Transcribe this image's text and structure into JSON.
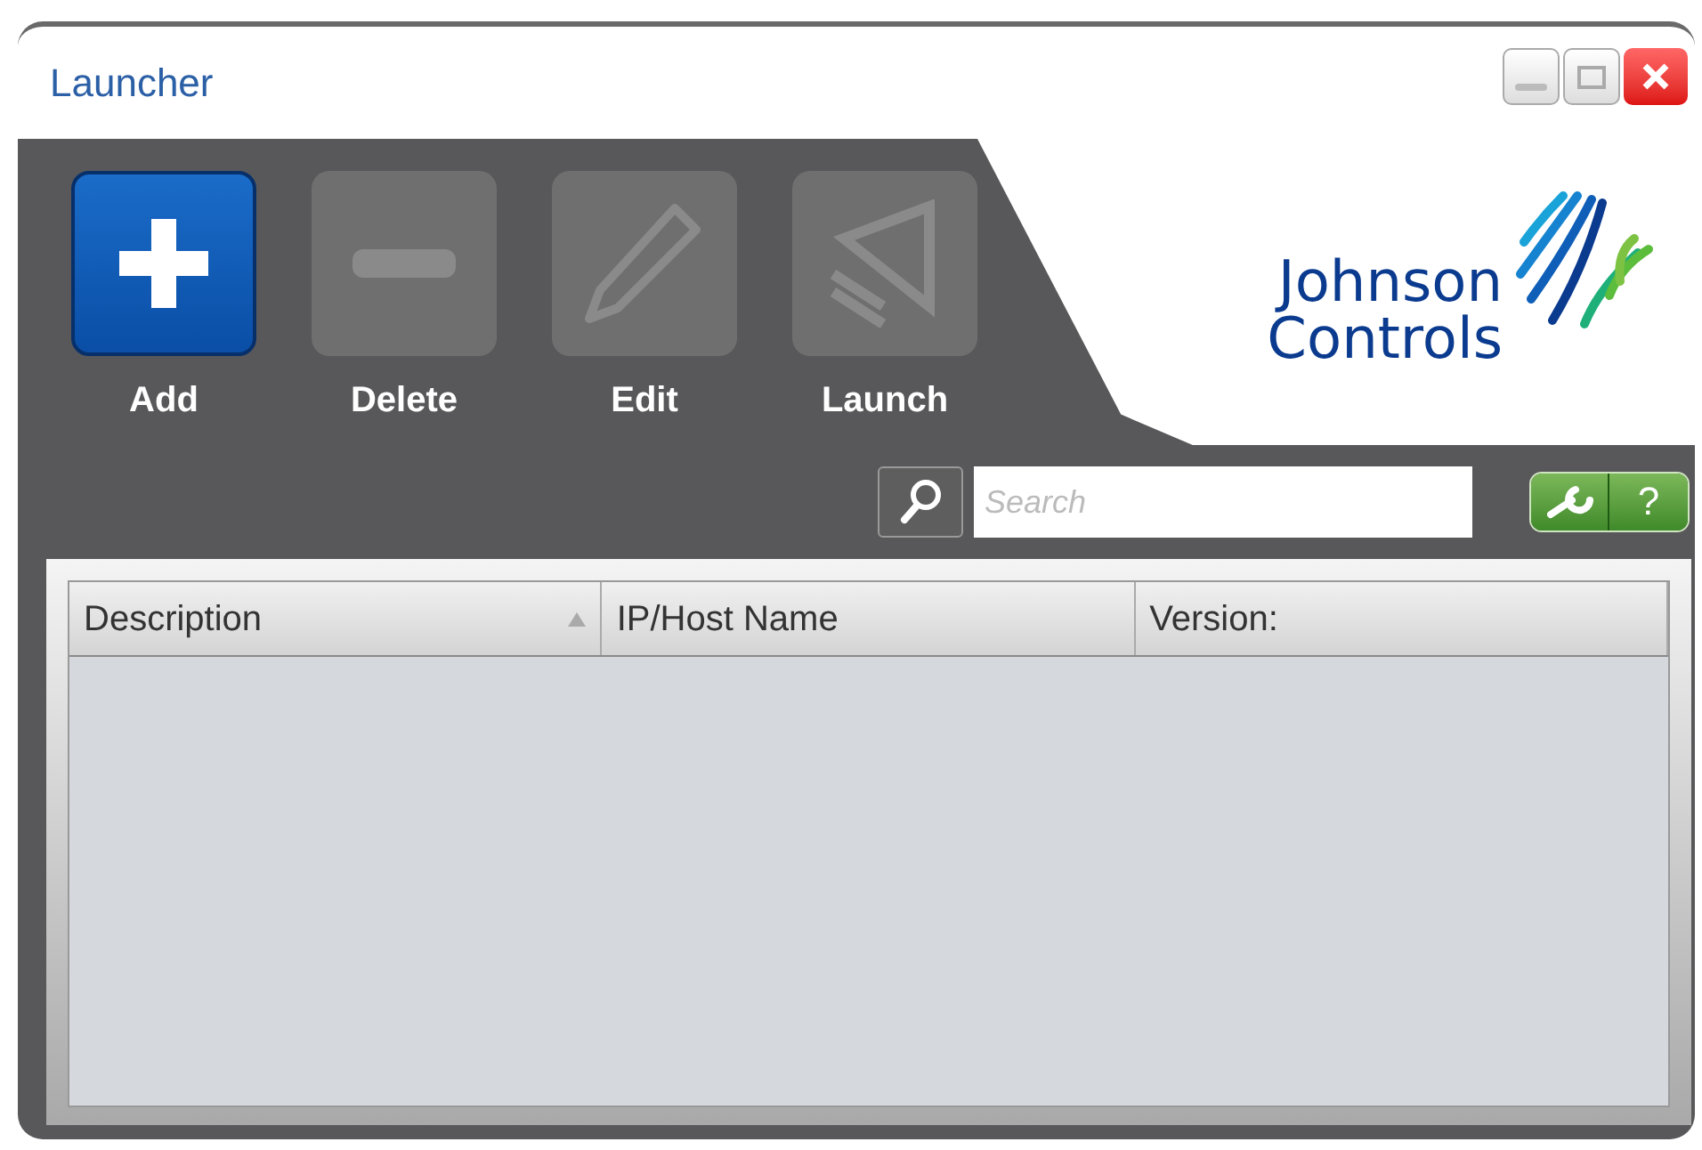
{
  "window": {
    "title": "Launcher"
  },
  "toolbar": [
    {
      "label": "Add",
      "kind": "add",
      "disabled": false
    },
    {
      "label": "Delete",
      "kind": "delete",
      "disabled": true
    },
    {
      "label": "Edit",
      "kind": "edit",
      "disabled": true
    },
    {
      "label": "Launch",
      "kind": "launch",
      "disabled": true
    }
  ],
  "logo": {
    "lines": [
      "Johnson",
      "Controls"
    ]
  },
  "search": {
    "placeholder": "Search"
  },
  "help_button": "?",
  "table": {
    "columns": [
      {
        "label": "Description",
        "sorted": true
      },
      {
        "label": "IP/Host Name",
        "sorted": false
      },
      {
        "label": "Version:",
        "sorted": false
      }
    ]
  }
}
